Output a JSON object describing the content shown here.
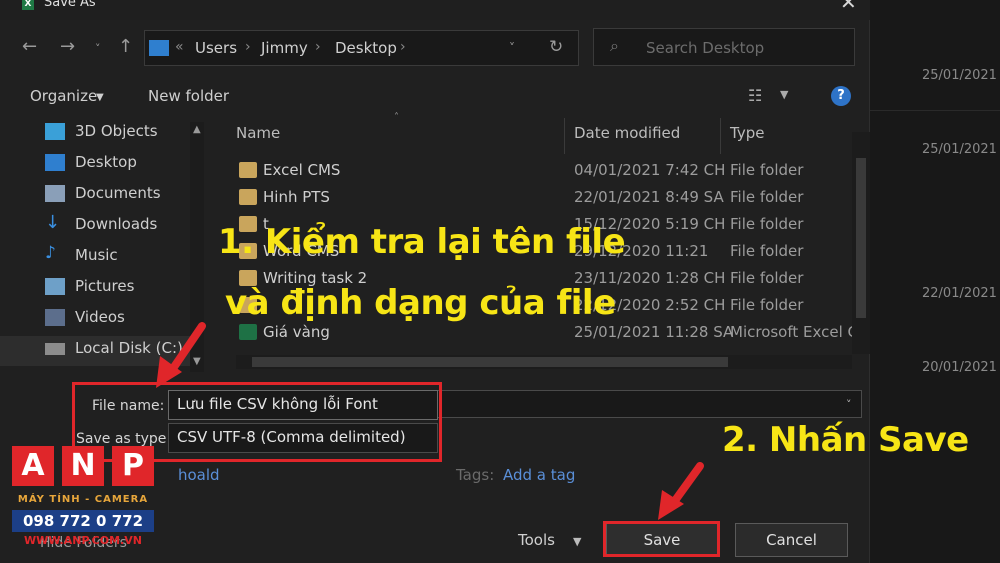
{
  "window": {
    "title": "Save As",
    "app_icon": "excel-icon"
  },
  "address_bar": {
    "path": [
      "Users",
      "Jimmy",
      "Desktop"
    ],
    "overflow": "«"
  },
  "search": {
    "placeholder": "Search Desktop"
  },
  "toolbar": {
    "organize": "Organize",
    "new_folder": "New folder",
    "help": "?"
  },
  "sidebar": {
    "items": [
      {
        "label": "3D Objects",
        "icon": "cube-icon"
      },
      {
        "label": "Desktop",
        "icon": "desktop-icon"
      },
      {
        "label": "Documents",
        "icon": "documents-icon"
      },
      {
        "label": "Downloads",
        "icon": "download-icon"
      },
      {
        "label": "Music",
        "icon": "music-icon"
      },
      {
        "label": "Pictures",
        "icon": "pictures-icon"
      },
      {
        "label": "Videos",
        "icon": "videos-icon"
      },
      {
        "label": "Local Disk (C:)",
        "icon": "disk-icon"
      }
    ]
  },
  "file_list": {
    "columns": {
      "name": "Name",
      "date": "Date modified",
      "type": "Type"
    },
    "rows": [
      {
        "name": "Excel CMS",
        "date": "04/01/2021 7:42 CH",
        "type": "File folder",
        "icon": "folder-icon"
      },
      {
        "name": "Hinh PTS",
        "date": "22/01/2021 8:49 SA",
        "type": "File folder",
        "icon": "folder-icon"
      },
      {
        "name": "t",
        "date": "15/12/2020 5:19 CH",
        "type": "File folder",
        "icon": "folder-icon"
      },
      {
        "name": "Word CMS",
        "date": "29/12/2020 11:21",
        "type": "File folder",
        "icon": "folder-icon"
      },
      {
        "name": "Writing task 2",
        "date": "23/11/2020 1:28 CH",
        "type": "File folder",
        "icon": "folder-icon"
      },
      {
        "name": "",
        "date": "22/12/2020 2:52 CH",
        "type": "File folder",
        "icon": "folder-icon"
      },
      {
        "name": "Giá vàng",
        "date": "25/01/2021 11:28 SA",
        "type": "Microsoft Excel C",
        "icon": "excel-file-icon"
      }
    ]
  },
  "form": {
    "file_name_label": "File name:",
    "file_name_value": "Lưu file CSV không lỗi Font",
    "save_type_label": "Save as type:",
    "save_type_value": "CSV UTF-8 (Comma delimited)",
    "authors_value": "hoald",
    "tags_label": "Tags:",
    "tags_placeholder": "Add a tag"
  },
  "footer": {
    "hide_folders": "Hide Folders",
    "tools": "Tools",
    "save": "Save",
    "cancel": "Cancel"
  },
  "background_dates": [
    "25/01/2021",
    "25/01/2021",
    "22/01/2021",
    "20/01/2021"
  ],
  "annotations": {
    "step1_line1": "1. Kiểm tra lại tên file",
    "step1_line2": "và định dạng của file",
    "step2": "2. Nhấn Save"
  },
  "watermark": {
    "letters": [
      "A",
      "N",
      "P"
    ],
    "tagline": "MÁY TÍNH - CAMERA",
    "phone": "098 772 0 772",
    "website": "WWW.ANP.COM.VN"
  },
  "colors": {
    "highlight": "#e0262a",
    "annotation": "#f7e516",
    "accent": "#2e73c7"
  }
}
